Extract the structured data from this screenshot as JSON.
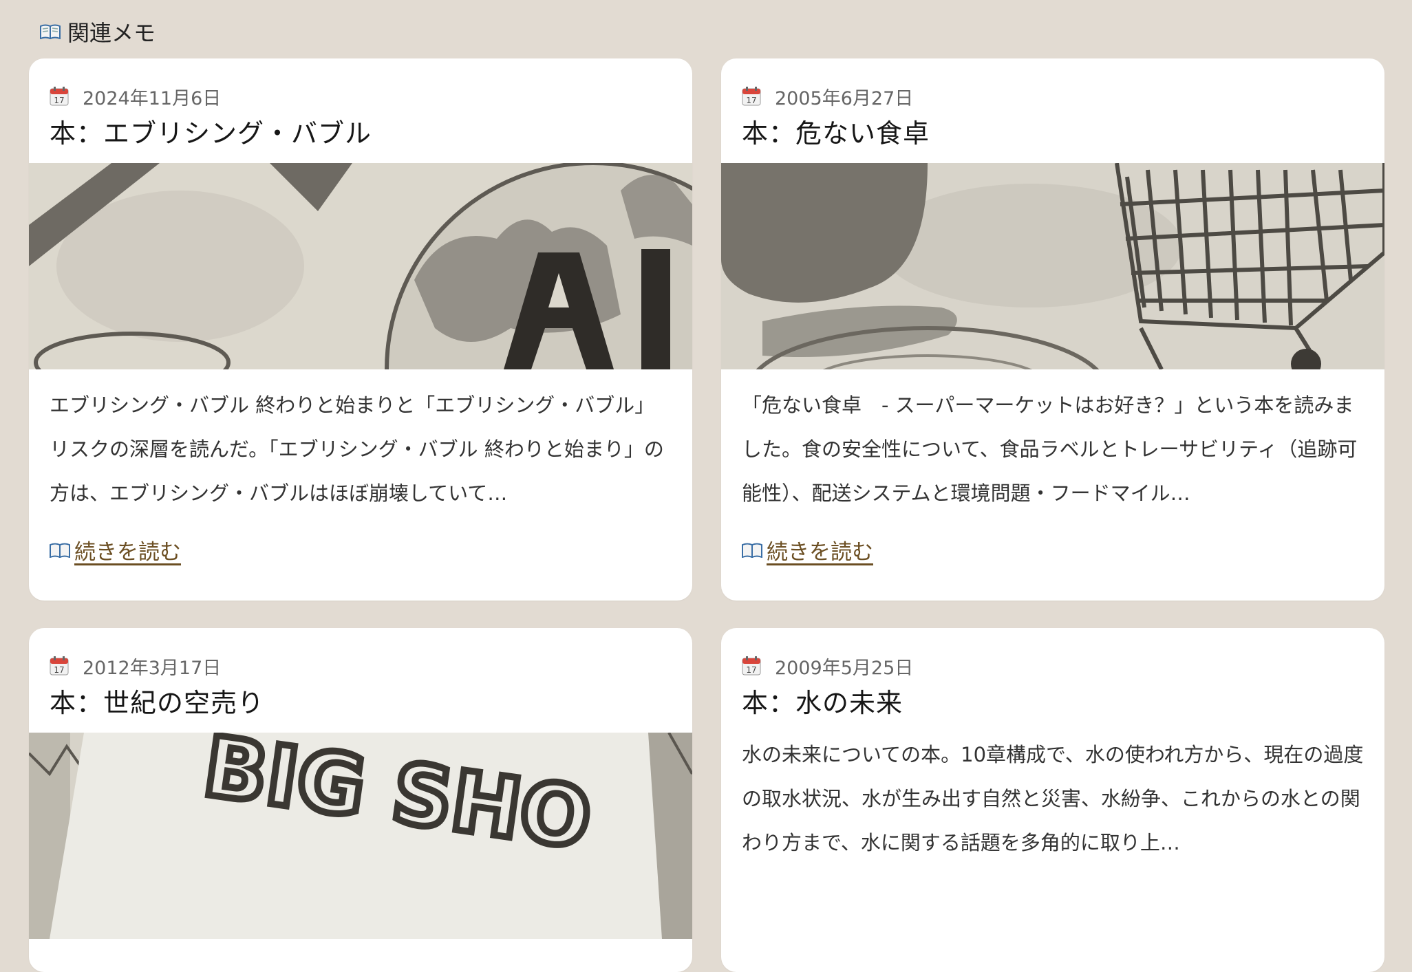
{
  "section": {
    "icon": "open-book-icon",
    "title": "関連メモ"
  },
  "colors": {
    "background": "#e2dbd2",
    "card": "#ffffff",
    "link": "#6b4e22",
    "date_text": "#666666"
  },
  "cards": [
    {
      "date_icon": "calendar-icon",
      "date": "2024年11月6日",
      "title": "本：エブリシング・バブル",
      "thumbnail": "watercolor-illustration-ai-globe",
      "excerpt": "エブリシング・バブル 終わりと始まりと「エブリシング・バブル」リスクの深層を読んだ。「エブリシング・バブル 終わりと始まり」の方は、エブリシング・バブルはほぼ崩壊していて…",
      "read_more": "続きを読む"
    },
    {
      "date_icon": "calendar-icon",
      "date": "2005年6月27日",
      "title": "本：危ない食卓",
      "thumbnail": "watercolor-illustration-shopping-cart",
      "excerpt": "「危ない食卓　- スーパーマーケットはお好き？」という本を読みました。食の安全性について、食品ラベルとトレーサビリティ（追跡可能性）、配送システムと環境問題・フードマイル…",
      "read_more": "続きを読む"
    },
    {
      "date_icon": "calendar-icon",
      "date": "2012年3月17日",
      "title": "本：世紀の空売り",
      "thumbnail": "watercolor-illustration-big-short-book",
      "thumbnail_text": "BIG SHO"
    },
    {
      "date_icon": "calendar-icon",
      "date": "2009年5月25日",
      "title": "本：水の未来",
      "excerpt": "水の未来についての本。10章構成で、水の使われ方から、現在の過度の取水状況、水が生み出す自然と災害、水紛争、これからの水との関わり方まで、水に関する話題を多角的に取り上…"
    }
  ]
}
